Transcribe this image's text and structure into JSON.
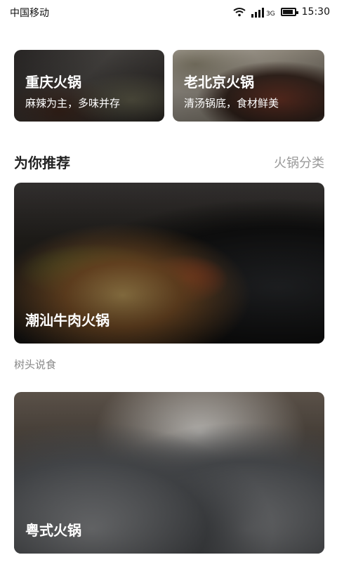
{
  "status_bar": {
    "carrier": "中国移动",
    "network": "3G",
    "time": "15:30",
    "icons": [
      "wifi-icon",
      "signal-icon",
      "battery-icon"
    ]
  },
  "top_cards": [
    {
      "title": "重庆火锅",
      "subtitle": "麻辣为主，多味并存"
    },
    {
      "title": "老北京火锅",
      "subtitle": "清汤锅底，食材鲜美"
    }
  ],
  "recommend": {
    "title": "为你推荐",
    "category_link": "火锅分类",
    "items": [
      {
        "title": "潮汕牛肉火锅",
        "source": "树头说食"
      },
      {
        "title": "粤式火锅"
      }
    ]
  }
}
